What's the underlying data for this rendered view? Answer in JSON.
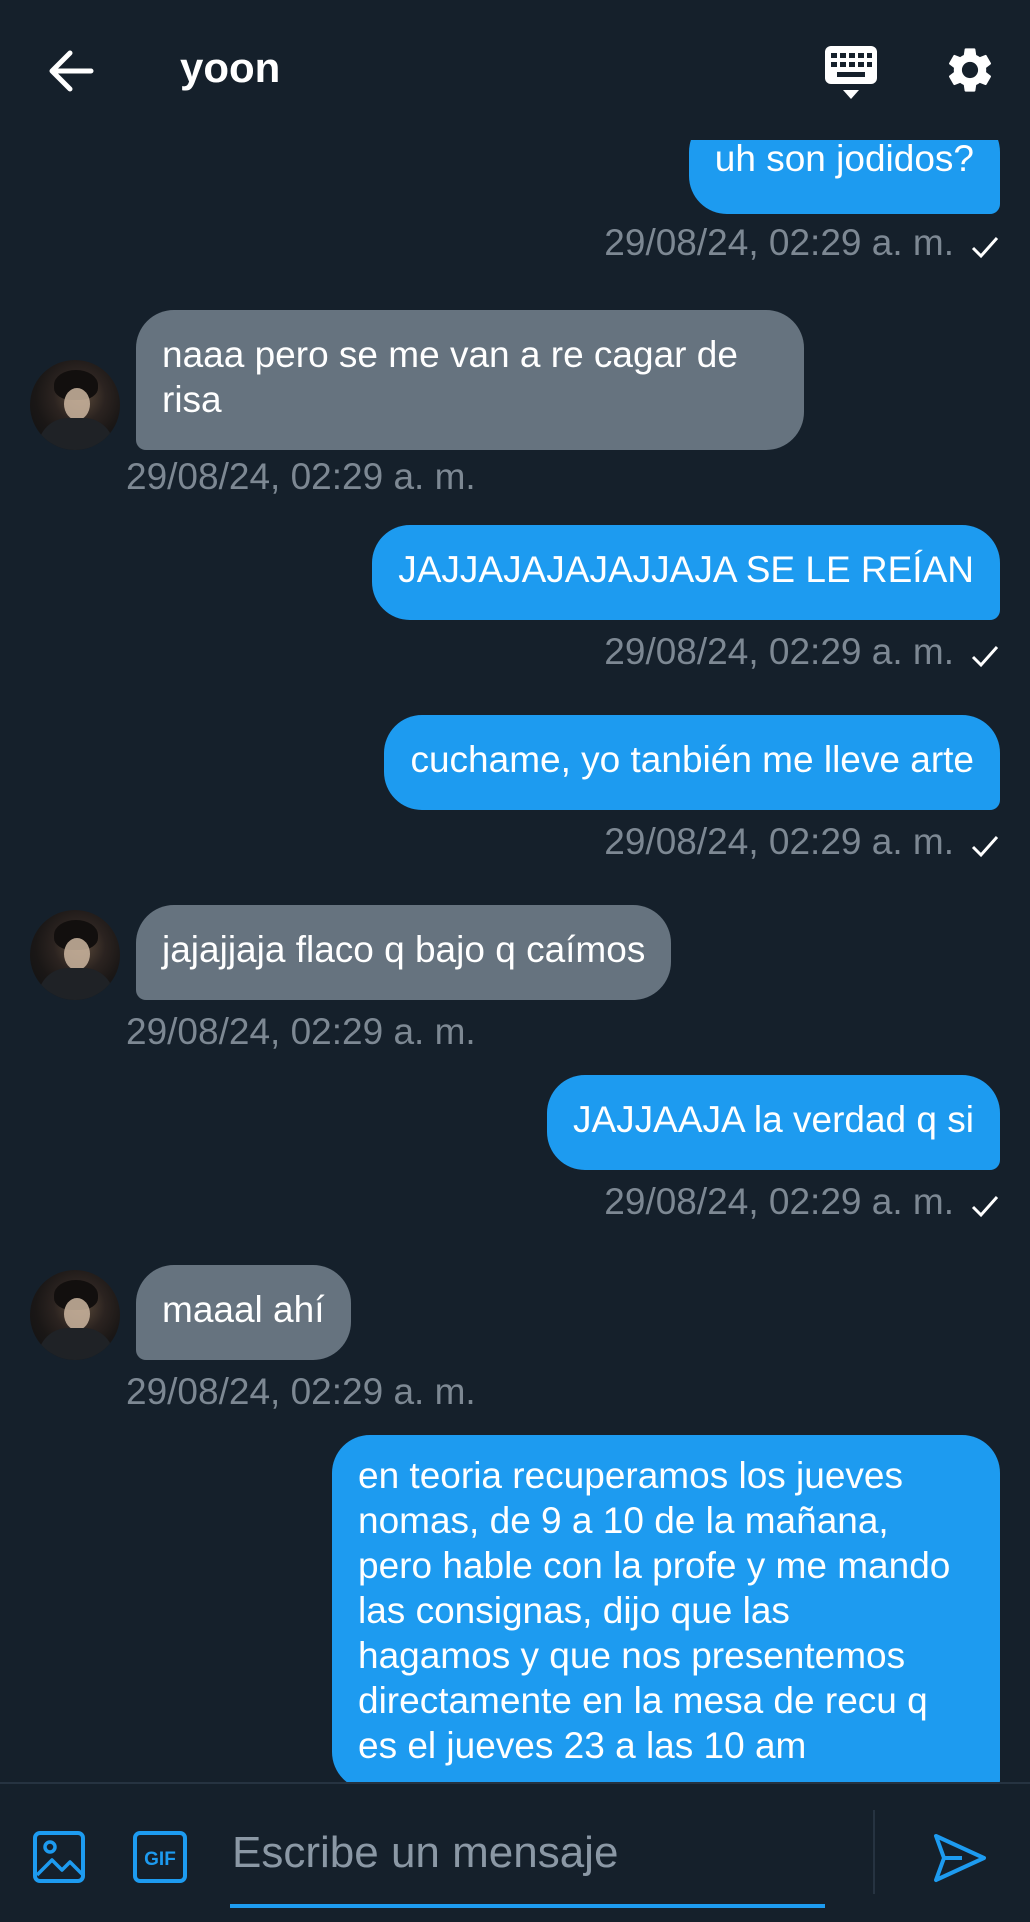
{
  "header": {
    "title": "yoon",
    "icons": [
      "arrow-left-icon",
      "keyboard-icon",
      "gear-icon"
    ]
  },
  "messages": [
    {
      "direction": "out",
      "text": "uh son jodidos?",
      "time": "29/08/24, 02:29 a. m.",
      "read": true
    },
    {
      "direction": "in",
      "text": "naaa pero se me van a re cagar de\nrisa",
      "time": "29/08/24, 02:29 a. m."
    },
    {
      "direction": "out",
      "text": "JAJJAJAJAJAJJAJA SE LE REÍAN",
      "time": "29/08/24, 02:29 a. m.",
      "read": true
    },
    {
      "direction": "out",
      "text": "cuchame, yo tanbién me lleve arte",
      "time": "29/08/24, 02:29 a. m.",
      "read": true
    },
    {
      "direction": "in",
      "text": "jajajjaja flaco q bajo q caímos",
      "time": "29/08/24, 02:29 a. m."
    },
    {
      "direction": "out",
      "text": "JAJJAAJA la verdad q si",
      "time": "29/08/24, 02:29 a. m.",
      "read": true
    },
    {
      "direction": "in",
      "text": "maaal ahí",
      "time": "29/08/24, 02:29 a. m."
    },
    {
      "direction": "out",
      "text": "en teoria recuperamos los jueves\nnomas, de 9 a 10 de la mañana,\npero hable con la profe y me mando\nlas consignas, dijo que las\nhagamos y que nos presentemos\ndirectamente en la mesa de recu q\nes el jueves 23 a las 10 am"
    }
  ],
  "composer": {
    "placeholder": "Escribe un mensaje",
    "gif_label": "GIF",
    "icons": [
      "image-icon",
      "gif-icon",
      "send-icon"
    ]
  },
  "colors": {
    "background": "#15202b",
    "outgoing_bubble": "#1d9bf0",
    "incoming_bubble": "#66737f",
    "timestamp": "#7d8893"
  }
}
